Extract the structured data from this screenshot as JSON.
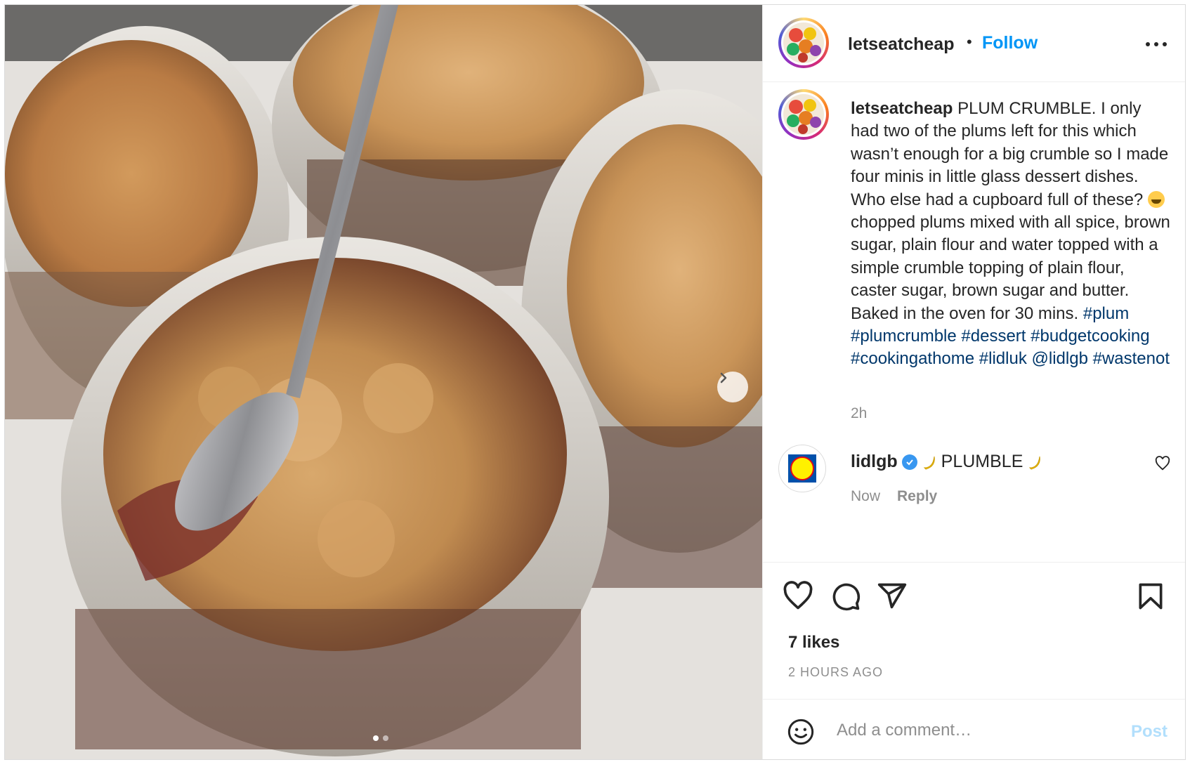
{
  "post": {
    "author": "letseatcheap",
    "follow_label": "Follow",
    "separator": "•",
    "caption": {
      "author": "letseatcheap",
      "text_before_emoji": "PLUM CRUMBLE. I only had two of the plums left for this which wasn’t enough for a big crumble so I made four minis in little glass dessert dishes. Who else had a cupboard full of these?",
      "text_after_emoji": "chopped plums mixed with all spice, brown sugar, plain flour and water topped with a simple crumble topping of plain flour, caster sugar, brown sugar and butter. Baked in the oven for 30 mins.",
      "emoji": "grinning-squinting-face",
      "hashtags": [
        "#plum",
        "#plumcrumble",
        "#dessert",
        "#budgetcooking",
        "#cookingathome",
        "#lidluk"
      ],
      "mention": "@lidlgb",
      "last_hashtag": "#wastenot"
    },
    "caption_time": "2h",
    "comment": {
      "author": "lidlgb",
      "verified": true,
      "text": "PLUMBLE",
      "emoji": "banana",
      "time": "Now",
      "reply_label": "Reply"
    },
    "likes": "7 likes",
    "time_ago": "2 HOURS AGO",
    "add_comment": {
      "placeholder": "Add a comment…",
      "post_label": "Post"
    },
    "carousel": {
      "current": 1,
      "total": 2
    },
    "colors": {
      "link_blue": "#0095f6",
      "hashtag": "#00376b",
      "muted": "#8e8e8e",
      "post_disabled": "#b2dffc"
    }
  }
}
